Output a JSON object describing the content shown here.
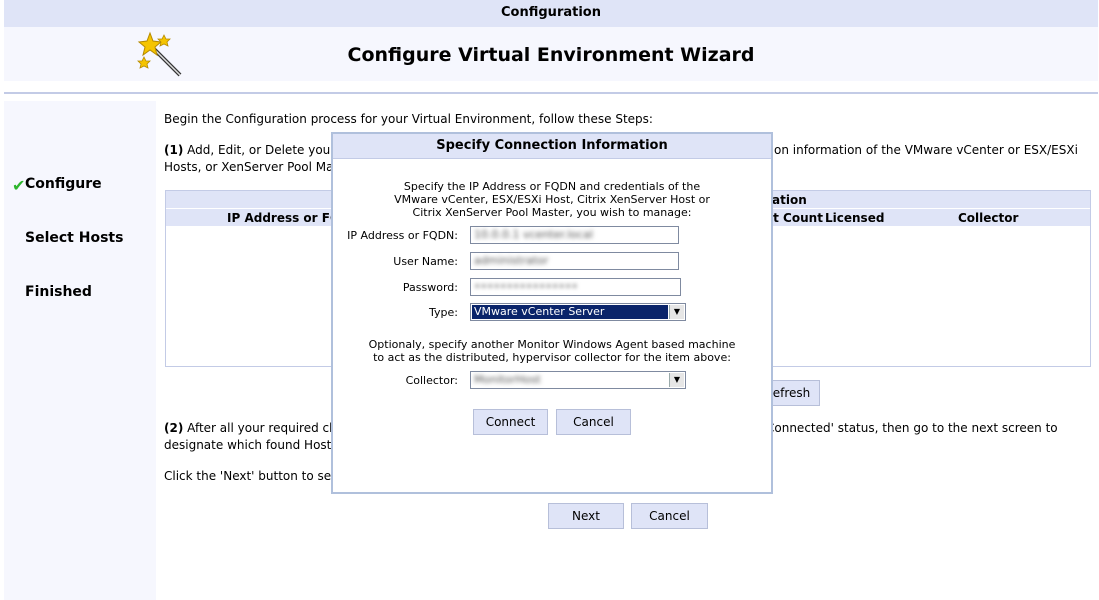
{
  "topbar": {
    "title": "Configuration"
  },
  "header": {
    "title": "Configure Virtual Environment Wizard"
  },
  "nav": {
    "items": [
      {
        "label": "Configure",
        "done": true
      },
      {
        "label": "Select Hosts"
      },
      {
        "label": "Finished"
      }
    ]
  },
  "content": {
    "intro": "Begin the Configuration process for your Virtual Environment, follow these Steps:",
    "step1_num": "(1)",
    "step1_left": "Add, Edit, or Delete your",
    "step1_right": "on information of the VMware vCenter or ESX/ESXi",
    "step1_line2": "Hosts, or XenServer Pool Ma",
    "table": {
      "header1": "ation",
      "columns": [
        "IP Address or FQDN",
        "st Count",
        "Licensed",
        "Collector"
      ]
    },
    "refresh_label": "efresh",
    "step2_num": "(2)",
    "step2_left": "After all your required cha",
    "step2_right": "Connected' status, then go to the next screen to",
    "step2_line2": "designate which found Hosts",
    "click_next": "Click the 'Next' button to sele",
    "next_label": "Next",
    "cancel_label": "Cancel"
  },
  "dialog": {
    "title": "Specify Connection Information",
    "intro_lines": [
      "Specify the IP Address or FQDN and credentials of the",
      "VMware vCenter, ESX/ESXi Host, Citrix XenServer Host or",
      "Citrix XenServer Pool Master, you wish to manage:"
    ],
    "fields": {
      "ip_label": "IP Address or FQDN:",
      "ip_value": "10.0.0.1 vcenter.local",
      "user_label": "User Name:",
      "user_value": "administrator",
      "password_label": "Password:",
      "password_value": "••••••••••••••••",
      "type_label": "Type:",
      "type_value": "VMware vCenter Server"
    },
    "mid_lines": [
      "Optionaly, specify another Monitor Windows Agent based machine",
      "to act as the distributed, hypervisor collector for the item above:"
    ],
    "collector_label": "Collector:",
    "collector_value": "MonitorHost",
    "connect_label": "Connect",
    "cancel_label": "Cancel"
  }
}
